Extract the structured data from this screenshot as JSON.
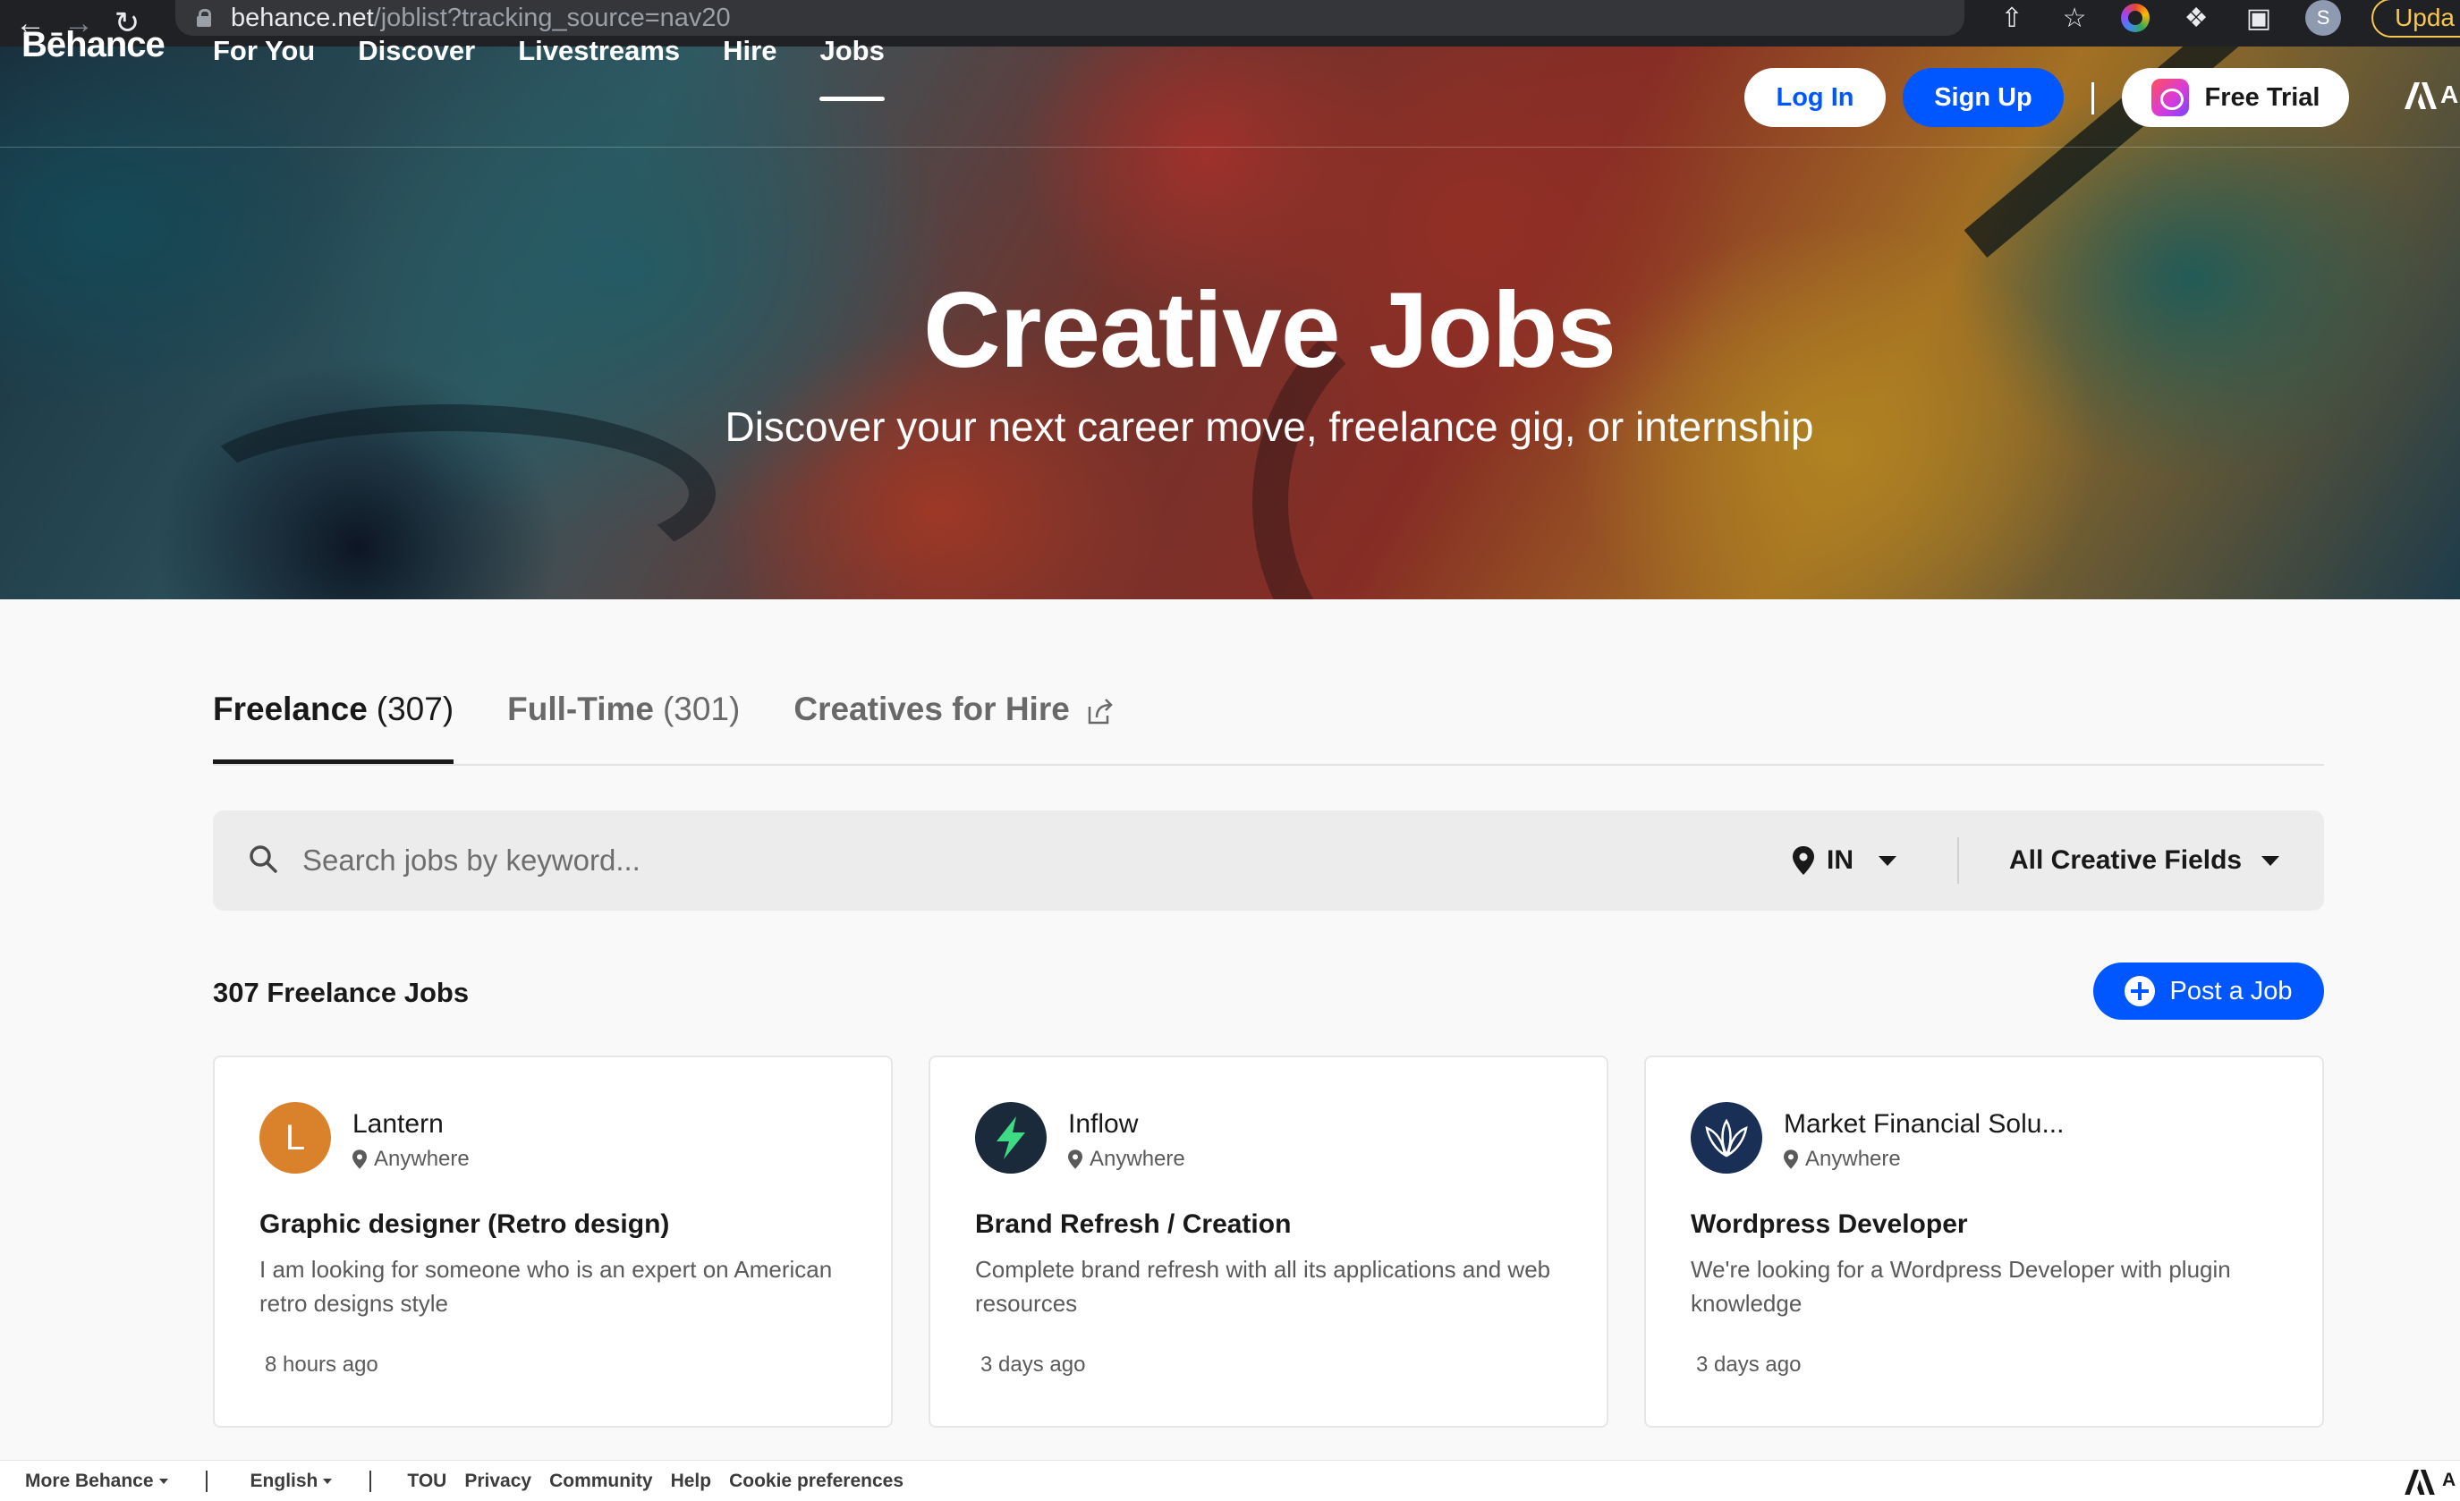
{
  "browser": {
    "url_host": "behance.net",
    "url_path": "/joblist?tracking_source=nav20",
    "profile_initial": "S",
    "update_label": "Upda"
  },
  "nav": {
    "logo": "Bēhance",
    "links": [
      "For You",
      "Discover",
      "Livestreams",
      "Hire",
      "Jobs"
    ],
    "active": "Jobs",
    "login": "Log In",
    "signup": "Sign Up",
    "trial": "Free Trial",
    "adobe_letter": "A"
  },
  "hero": {
    "title": "Creative Jobs",
    "subtitle": "Discover your next career move, freelance gig, or internship"
  },
  "tabs": [
    {
      "label": "Freelance",
      "count": "(307)"
    },
    {
      "label": "Full-Time",
      "count": "(301)"
    },
    {
      "label": "Creatives for Hire",
      "count": ""
    }
  ],
  "search": {
    "placeholder": "Search jobs by keyword...",
    "location": "IN",
    "field": "All Creative Fields"
  },
  "list": {
    "count_label": "307 Freelance Jobs",
    "post_label": "Post a Job"
  },
  "jobs": [
    {
      "initial": "L",
      "company": "Lantern",
      "location": "Anywhere",
      "title": "Graphic designer (Retro design)",
      "description": "I am looking for someone who is an expert on American retro designs style",
      "time": "8 hours ago",
      "logo_color": "#d9822b"
    },
    {
      "initial": "",
      "company": "Inflow",
      "location": "Anywhere",
      "title": "Brand Refresh / Creation",
      "description": "Complete brand refresh with all its applications and web resources",
      "time": "3 days ago",
      "logo_color": "#1b2a3a"
    },
    {
      "initial": "",
      "company": "Market Financial Solu...",
      "location": "Anywhere",
      "title": "Wordpress Developer",
      "description": "We're looking for a Wordpress Developer with plugin knowledge",
      "time": "3 days ago",
      "logo_color": "#1a2f55"
    }
  ],
  "footer": {
    "more": "More Behance",
    "language": "English",
    "links": [
      "TOU",
      "Privacy",
      "Community",
      "Help",
      "Cookie preferences"
    ],
    "adobe_letter": "A"
  }
}
